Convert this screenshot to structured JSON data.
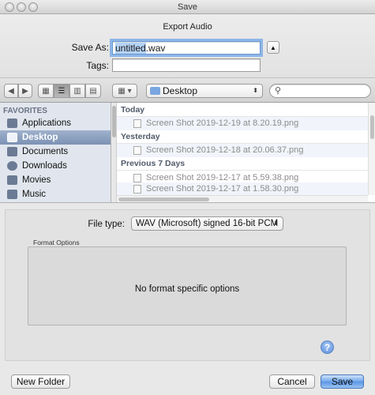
{
  "window": {
    "title": "Save"
  },
  "dialog": {
    "subtitle": "Export Audio",
    "save_as_label": "Save As:",
    "filename_selected": "untitled",
    "filename_ext": ".wav",
    "tags_label": "Tags:",
    "tags_value": ""
  },
  "toolbar": {
    "location": "Desktop",
    "search_placeholder": ""
  },
  "sidebar": {
    "heading": "FAVORITES",
    "items": [
      {
        "label": "Applications",
        "icon": "applications-icon",
        "active": false
      },
      {
        "label": "Desktop",
        "icon": "desktop-icon",
        "active": true
      },
      {
        "label": "Documents",
        "icon": "documents-icon",
        "active": false
      },
      {
        "label": "Downloads",
        "icon": "downloads-icon",
        "active": false
      },
      {
        "label": "Movies",
        "icon": "movies-icon",
        "active": false
      },
      {
        "label": "Music",
        "icon": "music-icon",
        "active": false
      }
    ]
  },
  "files": {
    "groups": [
      {
        "label": "Today",
        "items": [
          "Screen Shot 2019-12-19 at 8.20.19.png"
        ]
      },
      {
        "label": "Yesterday",
        "items": [
          "Screen Shot 2019-12-18 at 20.06.37.png"
        ]
      },
      {
        "label": "Previous 7 Days",
        "items": [
          "Screen Shot 2019-12-17 at 5.59.38.png",
          "Screen Shot 2019-12-17 at 1.58.30.png"
        ]
      }
    ]
  },
  "accessory": {
    "file_type_label": "File type:",
    "file_type_value": "WAV (Microsoft) signed 16-bit PCM",
    "format_options_label": "Format Options",
    "format_options_message": "No format specific options",
    "help_label": "?"
  },
  "buttons": {
    "new_folder": "New Folder",
    "cancel": "Cancel",
    "save": "Save"
  },
  "colors": {
    "accent": "#5a95e4",
    "sidebar_bg": "#e1e6ee",
    "sidebar_selected": "#7c92b4"
  }
}
